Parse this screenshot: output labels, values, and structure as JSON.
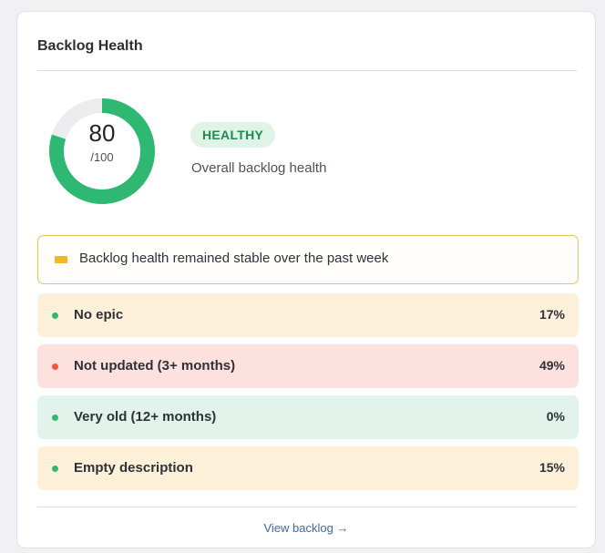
{
  "card": {
    "title": "Backlog Health"
  },
  "gauge": {
    "score": "80",
    "max_label": "/100",
    "score_fraction": 0.8,
    "color": "#2eb872",
    "track_color": "#ececee"
  },
  "status": {
    "badge": "HEALTHY",
    "caption": "Overall backlog health"
  },
  "trend": {
    "icon": "minus-bar-icon",
    "text": "Backlog health remained stable over the past week"
  },
  "metrics": [
    {
      "label": "No epic",
      "value": "17%",
      "bg": "#fdf0d8",
      "dot": "#2eb872"
    },
    {
      "label": "Not updated (3+ months)",
      "value": "49%",
      "bg": "#fde1de",
      "dot": "#f2553c"
    },
    {
      "label": "Very old (12+ months)",
      "value": "0%",
      "bg": "#e1f3ea",
      "dot": "#2eb872"
    },
    {
      "label": "Empty description",
      "value": "15%",
      "bg": "#fdf0d8",
      "dot": "#2eb872"
    }
  ],
  "footer": {
    "link": "View backlog →"
  }
}
